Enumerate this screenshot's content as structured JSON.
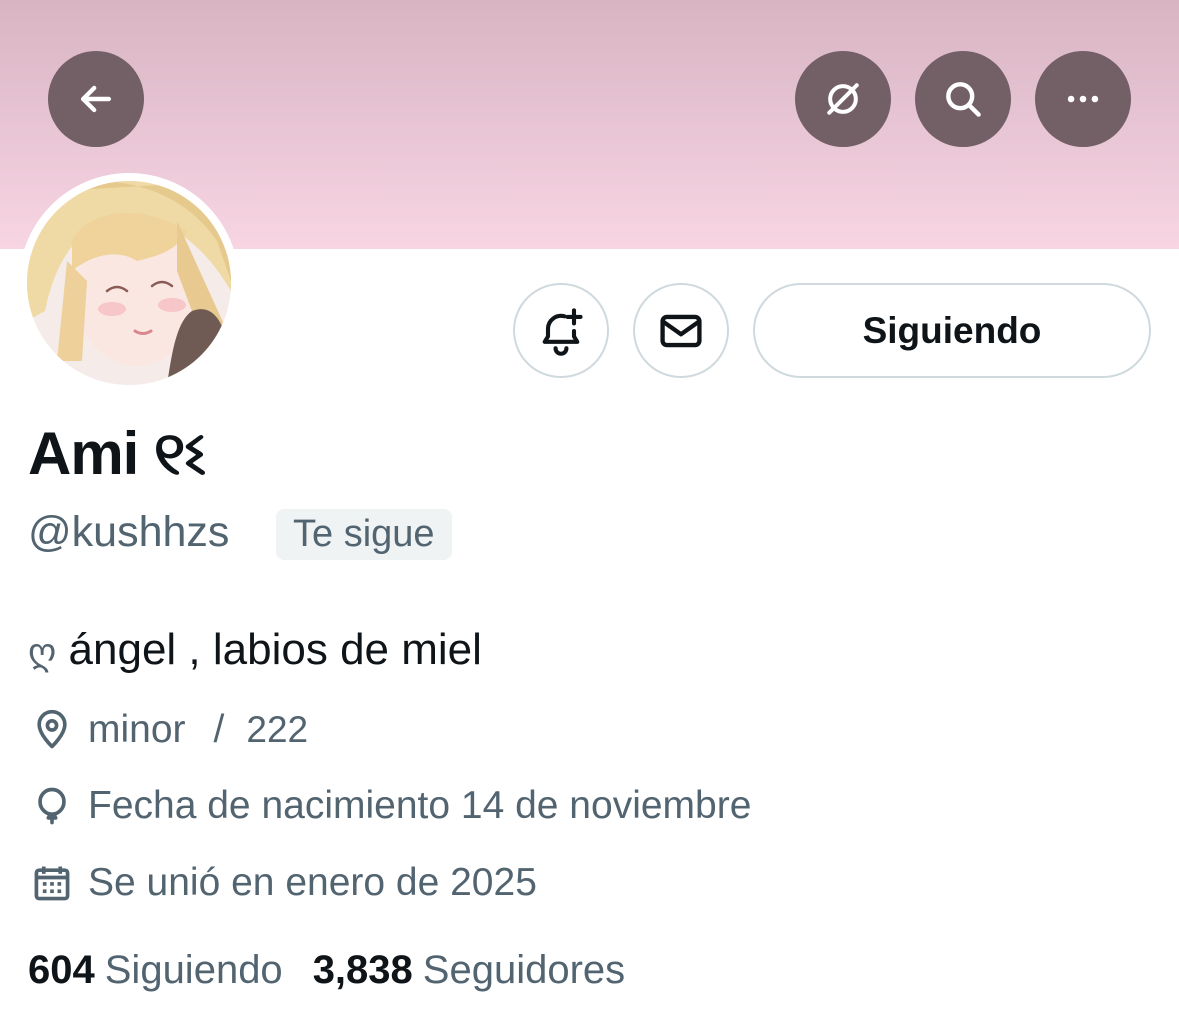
{
  "header": {
    "back_icon": "arrow-left-icon",
    "grok_icon": "grok-icon",
    "search_icon": "search-icon",
    "more_icon": "more-horizontal-icon",
    "banner_colors": [
      "#d8b4c2",
      "#f8d5e3"
    ]
  },
  "actions": {
    "notify_icon": "bell-plus-icon",
    "message_icon": "envelope-icon",
    "following_label": "Siguiendo"
  },
  "profile": {
    "display_name": "Ami ୧ଽ",
    "handle": "@kushhzs",
    "follows_you": "Te sigue",
    "bio_emoji": "ღ",
    "bio_text": "ángel , labios de miel",
    "location": "minor",
    "location_sep": "/",
    "location_extra": "222",
    "birthday": "Fecha de nacimiento 14 de noviembre",
    "joined": "Se unió en enero de 2025"
  },
  "stats": {
    "following_count": "604",
    "following_label": "Siguiendo",
    "followers_count": "3,838",
    "followers_label": "Seguidores"
  },
  "colors": {
    "icon_button_bg": "#735f66",
    "secondary_text": "#536471",
    "primary_text": "#0f1419",
    "border": "#cfd9de"
  }
}
